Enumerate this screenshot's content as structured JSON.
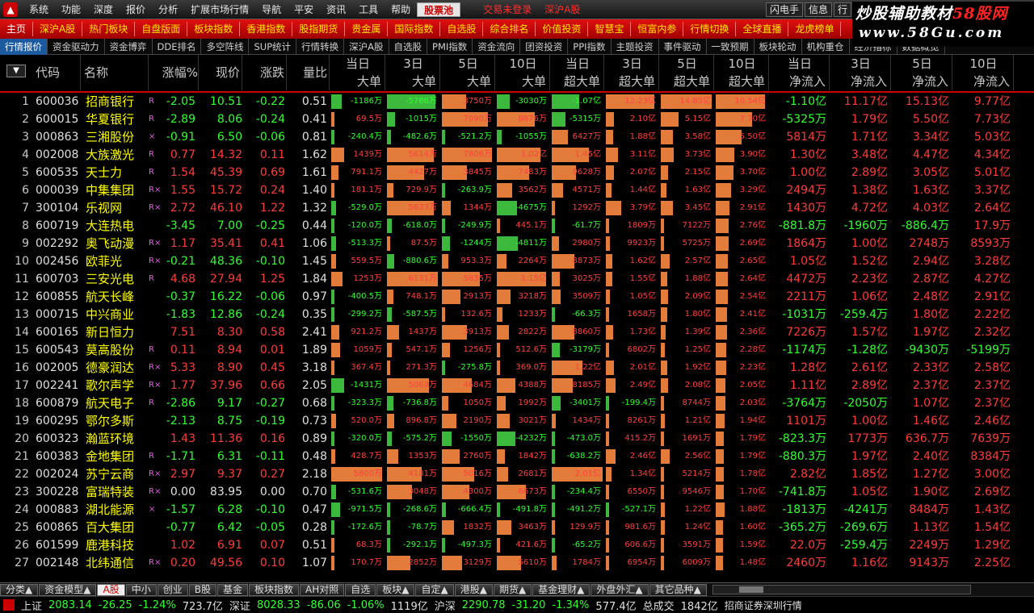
{
  "menu": {
    "items": [
      "系统",
      "功能",
      "深度",
      "报价",
      "分析",
      "扩展市场行情",
      "导航",
      "平安",
      "资讯",
      "工具",
      "帮助"
    ],
    "highlight": "股票池",
    "red_items": [
      "交易未登录",
      "深沪A股"
    ],
    "right_items": [
      "闪电手",
      "信息",
      "行"
    ]
  },
  "brand": {
    "line1_a": "炒股辅助教材",
    "line1_b": "58股网",
    "line2": "www.58Gu.com"
  },
  "redbar": [
    "主页",
    "深沪A股",
    "热门板块",
    "自盘版面",
    "板块指数",
    "香港指数",
    "股指期货",
    "贵金属",
    "国际指数",
    "自选股",
    "综合排名",
    "价值投资",
    "智慧宝",
    "恒富内参",
    "行情切换",
    "全球直播",
    "龙虎榜单"
  ],
  "tabs": [
    "行情报价",
    "资金驱动力",
    "资金博弈",
    "DDE排名",
    "多空阵线",
    "SUP统计",
    "行情转换",
    "深沪A股",
    "自选股",
    "PMI指数",
    "资金流向",
    "团资投资",
    "PPI指数",
    "主题投资",
    "事件驱动",
    "一致预期",
    "板块轮动",
    "机构重仓",
    "经济指标",
    "数据概览"
  ],
  "active_tab": 0,
  "header": {
    "code": "代码",
    "name": "名称",
    "chg_pct": "涨幅%",
    "price": "现价",
    "chg": "涨跌",
    "vol_ratio": "量比",
    "groups": [
      {
        "top": "当日",
        "bottom": "大单"
      },
      {
        "top": "3日",
        "bottom": "大单"
      },
      {
        "top": "5日",
        "bottom": "大单"
      },
      {
        "top": "10日",
        "bottom": "大单"
      },
      {
        "top": "当日",
        "bottom": "超大单"
      },
      {
        "top": "3日",
        "bottom": "超大单"
      },
      {
        "top": "5日",
        "bottom": "超大单"
      },
      {
        "top": "10日",
        "bottom": "超大单"
      },
      {
        "top": "当日",
        "bottom": "净流入"
      },
      {
        "top": "3日",
        "bottom": "净流入"
      },
      {
        "top": "5日",
        "bottom": "净流入"
      },
      {
        "top": "10日",
        "bottom": "净流入"
      }
    ]
  },
  "rows": [
    {
      "i": "1",
      "code": "600036",
      "name": "招商银行",
      "flag": "R",
      "pct": "-2.05",
      "price": "10.51",
      "chg": "-0.22",
      "vr": "0.51",
      "b": [
        "-1186万",
        "-5786万",
        "3750万",
        "-3030万"
      ],
      "s": [
        "-1.07亿",
        "12.23亿",
        "14.85亿",
        "10.54亿"
      ],
      "n": [
        "-1.10亿",
        "11.17亿",
        "15.13亿",
        "9.77亿"
      ]
    },
    {
      "i": "2",
      "code": "600015",
      "name": "华夏银行",
      "flag": "R",
      "pct": "-2.89",
      "price": "8.06",
      "chg": "-0.24",
      "vr": "0.41",
      "b": [
        "69.5万",
        "-1015万",
        "7090万",
        "8876万"
      ],
      "s": [
        "-5315万",
        "2.10亿",
        "5.15亿",
        "7.70亿"
      ],
      "n": [
        "-5325万",
        "1.79亿",
        "5.50亿",
        "7.73亿"
      ]
    },
    {
      "i": "3",
      "code": "000863",
      "name": "三湘股份",
      "flag": "×",
      "pct": "-0.91",
      "price": "6.50",
      "chg": "-0.06",
      "vr": "0.81",
      "b": [
        "-240.4万",
        "-482.6万",
        "-521.2万",
        "-1055万"
      ],
      "s": [
        "6427万",
        "1.88亿",
        "3.58亿",
        "5.50亿"
      ],
      "n": [
        "5814万",
        "1.71亿",
        "3.34亿",
        "5.03亿"
      ]
    },
    {
      "i": "4",
      "code": "002008",
      "name": "大族激光",
      "flag": "R",
      "pct": "0.77",
      "price": "14.32",
      "chg": "0.11",
      "vr": "1.62",
      "b": [
        "1439万",
        "5614万",
        "7806万",
        "1.02亿"
      ],
      "s": [
        "1.45亿",
        "3.11亿",
        "3.73亿",
        "3.90亿"
      ],
      "n": [
        "1.30亿",
        "3.48亿",
        "4.47亿",
        "4.34亿"
      ]
    },
    {
      "i": "5",
      "code": "600535",
      "name": "天士力",
      "flag": "R",
      "pct": "1.54",
      "price": "45.39",
      "chg": "0.69",
      "vr": "1.61",
      "b": [
        "791.1万",
        "4427万",
        "3845万",
        "7483万"
      ],
      "s": [
        "9628万",
        "2.07亿",
        "2.15亿",
        "3.70亿"
      ],
      "n": [
        "1.00亿",
        "2.89亿",
        "3.05亿",
        "5.01亿"
      ]
    },
    {
      "i": "6",
      "code": "000039",
      "name": "中集集团",
      "flag": "R×",
      "pct": "1.55",
      "price": "15.72",
      "chg": "0.24",
      "vr": "1.40",
      "b": [
        "181.1万",
        "729.9万",
        "-263.9万",
        "3562万"
      ],
      "s": [
        "4571万",
        "1.44亿",
        "1.63亿",
        "3.29亿"
      ],
      "n": [
        "2494万",
        "1.38亿",
        "1.63亿",
        "3.37亿"
      ]
    },
    {
      "i": "7",
      "code": "300104",
      "name": "乐视网",
      "flag": "R×",
      "pct": "2.72",
      "price": "46.10",
      "chg": "1.22",
      "vr": "1.32",
      "b": [
        "-529.0万",
        "5633万",
        "1344万",
        "-4675万"
      ],
      "s": [
        "1292万",
        "3.79亿",
        "3.45亿",
        "2.91亿"
      ],
      "n": [
        "1430万",
        "4.72亿",
        "4.03亿",
        "2.64亿"
      ]
    },
    {
      "i": "8",
      "code": "600719",
      "name": "大连热电",
      "flag": "",
      "pct": "-3.45",
      "price": "7.00",
      "chg": "-0.25",
      "vr": "0.44",
      "b": [
        "-120.0万",
        "-618.0万",
        "-249.9万",
        "445.1万"
      ],
      "s": [
        "-61.7万",
        "1809万",
        "7122万",
        "2.76亿"
      ],
      "n": [
        "-881.8万",
        "-1960万",
        "-886.4万",
        "17.9万"
      ]
    },
    {
      "i": "9",
      "code": "002292",
      "name": "奥飞动漫",
      "flag": "R×",
      "pct": "1.17",
      "price": "35.41",
      "chg": "0.41",
      "vr": "1.06",
      "b": [
        "-513.3万",
        "87.5万",
        "-1244万",
        "-4811万"
      ],
      "s": [
        "2980万",
        "9923万",
        "5725万",
        "2.69亿"
      ],
      "n": [
        "1864万",
        "1.00亿",
        "2748万",
        "8593万"
      ]
    },
    {
      "i": "10",
      "code": "002456",
      "name": "欧菲光",
      "flag": "R×",
      "pct": "-0.21",
      "price": "48.36",
      "chg": "-0.10",
      "vr": "1.45",
      "b": [
        "559.5万",
        "-880.6万",
        "953.3万",
        "2264万"
      ],
      "s": [
        "8873万",
        "1.62亿",
        "2.57亿",
        "2.65亿"
      ],
      "n": [
        "1.05亿",
        "1.52亿",
        "2.94亿",
        "3.28亿"
      ]
    },
    {
      "i": "11",
      "code": "600703",
      "name": "三安光电",
      "flag": "R",
      "pct": "4.68",
      "price": "27.94",
      "chg": "1.25",
      "vr": "1.84",
      "b": [
        "1253万",
        "6131万",
        "5835万",
        "1.15亿"
      ],
      "s": [
        "3025万",
        "1.55亿",
        "1.88亿",
        "2.64亿"
      ],
      "n": [
        "4472万",
        "2.23亿",
        "2.87亿",
        "4.27亿"
      ]
    },
    {
      "i": "12",
      "code": "600855",
      "name": "航天长峰",
      "flag": "",
      "pct": "-0.37",
      "price": "16.22",
      "chg": "-0.06",
      "vr": "0.97",
      "b": [
        "-400.5万",
        "748.1万",
        "2913万",
        "3218万"
      ],
      "s": [
        "3509万",
        "1.05亿",
        "2.09亿",
        "2.54亿"
      ],
      "n": [
        "2211万",
        "1.06亿",
        "2.48亿",
        "2.91亿"
      ]
    },
    {
      "i": "13",
      "code": "000715",
      "name": "中兴商业",
      "flag": "",
      "pct": "-1.83",
      "price": "12.86",
      "chg": "-0.24",
      "vr": "0.35",
      "b": [
        "-299.2万",
        "-587.5万",
        "132.6万",
        "1233万"
      ],
      "s": [
        "-66.3万",
        "1658万",
        "1.80亿",
        "2.41亿"
      ],
      "n": [
        "-1031万",
        "-259.4万",
        "1.80亿",
        "2.22亿"
      ]
    },
    {
      "i": "14",
      "code": "600165",
      "name": "新日恒力",
      "flag": "",
      "pct": "7.51",
      "price": "8.30",
      "chg": "0.58",
      "vr": "2.41",
      "b": [
        "921.2万",
        "1437万",
        "3913万",
        "2822万"
      ],
      "s": [
        "8860万",
        "1.73亿",
        "1.39亿",
        "2.36亿"
      ],
      "n": [
        "7226万",
        "1.57亿",
        "1.97亿",
        "2.32亿"
      ]
    },
    {
      "i": "15",
      "code": "600543",
      "name": "莫高股份",
      "flag": "R",
      "pct": "0.11",
      "price": "8.94",
      "chg": "0.01",
      "vr": "1.89",
      "b": [
        "1059万",
        "547.1万",
        "1256万",
        "512.6万"
      ],
      "s": [
        "-3179万",
        "6802万",
        "1.25亿",
        "2.28亿"
      ],
      "n": [
        "-1174万",
        "-1.28亿",
        "-9430万",
        "-5199万"
      ]
    },
    {
      "i": "16",
      "code": "002005",
      "name": "德豪润达",
      "flag": "R×",
      "pct": "5.33",
      "price": "8.90",
      "chg": "0.45",
      "vr": "3.18",
      "b": [
        "367.4万",
        "271.3万",
        "-275.8万",
        "369.0万"
      ],
      "s": [
        "1.22亿",
        "2.01亿",
        "1.92亿",
        "2.23亿"
      ],
      "n": [
        "1.28亿",
        "2.61亿",
        "2.33亿",
        "2.58亿"
      ]
    },
    {
      "i": "17",
      "code": "002241",
      "name": "歌尔声学",
      "flag": "R×",
      "pct": "1.77",
      "price": "37.96",
      "chg": "0.66",
      "vr": "2.05",
      "b": [
        "-1431万",
        "5069万",
        "4684万",
        "4388万"
      ],
      "s": [
        "8185万",
        "2.49亿",
        "2.08亿",
        "2.05亿"
      ],
      "n": [
        "1.11亿",
        "2.89亿",
        "2.37亿",
        "2.37亿"
      ]
    },
    {
      "i": "18",
      "code": "600879",
      "name": "航天电子",
      "flag": "R",
      "pct": "-2.86",
      "price": "9.17",
      "chg": "-0.27",
      "vr": "0.68",
      "b": [
        "-323.3万",
        "-736.8万",
        "1050万",
        "1992万"
      ],
      "s": [
        "-3401万",
        "-199.4万",
        "8744万",
        "2.03亿"
      ],
      "n": [
        "-3764万",
        "-2050万",
        "1.07亿",
        "2.37亿"
      ]
    },
    {
      "i": "19",
      "code": "600295",
      "name": "鄂尔多斯",
      "flag": "",
      "pct": "-2.13",
      "price": "8.75",
      "chg": "-0.19",
      "vr": "0.73",
      "b": [
        "520.0万",
        "896.8万",
        "2190万",
        "3021万"
      ],
      "s": [
        "1434万",
        "8261万",
        "1.21亿",
        "1.94亿"
      ],
      "n": [
        "1101万",
        "1.00亿",
        "1.46亿",
        "2.46亿"
      ]
    },
    {
      "i": "20",
      "code": "600323",
      "name": "瀚蓝环境",
      "flag": "",
      "pct": "1.43",
      "price": "11.36",
      "chg": "0.16",
      "vr": "0.89",
      "b": [
        "-320.0万",
        "-575.2万",
        "-1550万",
        "-4232万"
      ],
      "s": [
        "-473.0万",
        "415.2万",
        "1691万",
        "1.79亿"
      ],
      "n": [
        "-823.3万",
        "1773万",
        "636.7万",
        "7639万"
      ]
    },
    {
      "i": "21",
      "code": "600383",
      "name": "金地集团",
      "flag": "R",
      "pct": "-1.71",
      "price": "6.31",
      "chg": "-0.11",
      "vr": "0.48",
      "b": [
        "428.7万",
        "1353万",
        "2760万",
        "1842万"
      ],
      "s": [
        "-638.2万",
        "2.46亿",
        "2.56亿",
        "1.79亿"
      ],
      "n": [
        "-880.3万",
        "1.97亿",
        "2.40亿",
        "8384万"
      ]
    },
    {
      "i": "22",
      "code": "002024",
      "name": "苏宁云商",
      "flag": "R×",
      "pct": "2.97",
      "price": "9.37",
      "chg": "0.27",
      "vr": "2.18",
      "b": [
        "5800万",
        "4181万",
        "5016万",
        "2681万"
      ],
      "s": [
        "2.01亿",
        "1.34亿",
        "5214万",
        "1.78亿"
      ],
      "n": [
        "2.82亿",
        "1.85亿",
        "1.27亿",
        "3.00亿"
      ]
    },
    {
      "i": "23",
      "code": "300228",
      "name": "富瑞特装",
      "flag": "R×",
      "pct": "0.00",
      "price": "83.95",
      "chg": "0.00",
      "vr": "0.70",
      "b": [
        "-531.6万",
        "3048万",
        "4300万",
        "6673万"
      ],
      "s": [
        "-234.4万",
        "6550万",
        "9546万",
        "1.70亿"
      ],
      "n": [
        "-741.8万",
        "1.05亿",
        "1.90亿",
        "2.69亿"
      ]
    },
    {
      "i": "24",
      "code": "000883",
      "name": "湖北能源",
      "flag": "×",
      "pct": "-1.57",
      "price": "6.28",
      "chg": "-0.10",
      "vr": "0.47",
      "b": [
        "-971.5万",
        "-268.6万",
        "-666.4万",
        "-491.8万"
      ],
      "s": [
        "-491.2万",
        "-527.1万",
        "1.22亿",
        "1.88亿"
      ],
      "n": [
        "-1813万",
        "-4241万",
        "8484万",
        "1.43亿"
      ]
    },
    {
      "i": "25",
      "code": "600865",
      "name": "百大集团",
      "flag": "",
      "pct": "-0.77",
      "price": "6.42",
      "chg": "-0.05",
      "vr": "0.28",
      "b": [
        "-172.6万",
        "-78.7万",
        "1832万",
        "3463万"
      ],
      "s": [
        "129.9万",
        "981.6万",
        "1.24亿",
        "1.60亿"
      ],
      "n": [
        "-365.2万",
        "-269.6万",
        "1.13亿",
        "1.54亿"
      ]
    },
    {
      "i": "26",
      "code": "601599",
      "name": "鹿港科技",
      "flag": "",
      "pct": "1.02",
      "price": "6.91",
      "chg": "0.07",
      "vr": "0.51",
      "b": [
        "68.3万",
        "-292.1万",
        "-497.3万",
        "421.6万"
      ],
      "s": [
        "-65.2万",
        "606.6万",
        "3591万",
        "1.59亿"
      ],
      "n": [
        "22.0万",
        "-259.4万",
        "2249万",
        "1.29亿"
      ]
    },
    {
      "i": "27",
      "code": "002148",
      "name": "北纬通信",
      "flag": "R×",
      "pct": "0.20",
      "price": "49.56",
      "chg": "0.10",
      "vr": "1.07",
      "b": [
        "170.7万",
        "2852万",
        "3129万",
        "5610万"
      ],
      "s": [
        "1784万",
        "6954万",
        "6009万",
        "1.48亿"
      ],
      "n": [
        "2460万",
        "1.16亿",
        "9143万",
        "2.25亿"
      ]
    }
  ],
  "bottom_tabs": [
    "分类▲",
    "资金模型▲",
    "A股",
    "中小",
    "创业",
    "B股",
    "基金",
    "板块指数",
    "AH对照",
    "自选",
    "板块▲",
    "自定▲",
    "港股▲",
    "期货▲",
    "基金理财▲",
    "外盘外汇▲",
    "其它品种▲"
  ],
  "bottom_active": 2,
  "status": {
    "sh_label": "上证",
    "sh_val": "2083.14",
    "sh_chg": "-26.25",
    "sh_pct": "-1.24%",
    "sh_amt": "723.7亿",
    "sz_label": "深证",
    "sz_val": "8028.33",
    "sz_chg": "-86.06",
    "sz_pct": "-1.06%",
    "sz_amt": "1119亿",
    "hs_label": "沪深",
    "hs_val": "2290.78",
    "hs_chg": "-31.20",
    "hs_pct": "-1.34%",
    "hs_amt": "577.4亿",
    "total_label": "总成交",
    "total_val": "1842亿",
    "broker": "招商证券深圳行情"
  },
  "colors": {
    "up": "#ff3c3c",
    "down": "#30ff30",
    "bar_red": "#e37b3a",
    "bar_green": "#3cb83c",
    "accent": "#c00000"
  }
}
